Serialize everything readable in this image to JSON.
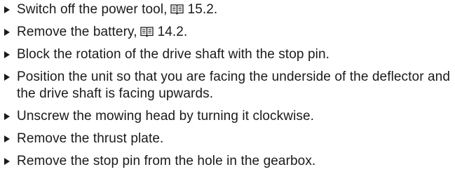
{
  "steps": [
    {
      "text": "Switch off the power tool,",
      "ref": "15.2."
    },
    {
      "text": "Remove the battery,",
      "ref": "14.2."
    },
    {
      "text": "Block the rotation of the drive shaft with the stop pin."
    },
    {
      "text": "Position the unit so that you are facing the underside of the deflector and the drive shaft is facing upwards."
    },
    {
      "text": "Unscrew the mowing head by turning it clockwise."
    },
    {
      "text": "Remove the thrust plate."
    },
    {
      "text": "Remove the stop pin from the hole in the gearbox."
    }
  ],
  "icons": {
    "bullet": "triangle-bullet-icon",
    "reference": "book-icon"
  },
  "colors": {
    "text": "#1a1a1a"
  }
}
